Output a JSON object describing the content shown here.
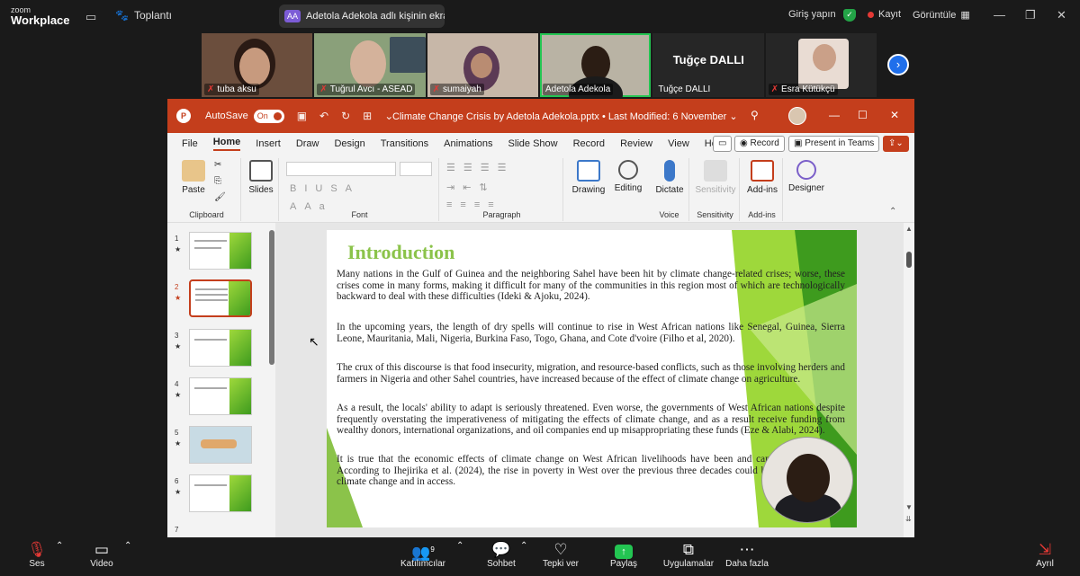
{
  "zoom": {
    "brand_line1": "zoom",
    "brand_line2": "Workplace",
    "meeting_label": "Toplantı",
    "share_label": "Adetola Adekola adlı kişinin ekra",
    "share_badge": "AA",
    "sign_in": "Giriş yapın",
    "record": "Kayıt",
    "view": "Görüntüle",
    "participants": [
      {
        "name": "tuba aksu",
        "muted": true
      },
      {
        "name": "Tuğrul Avcı - ASEAD",
        "muted": true
      },
      {
        "name": "sumaiyah",
        "muted": true
      },
      {
        "name": "Adetola Adekola",
        "muted": false
      },
      {
        "name": "Tuğçe DALLI",
        "muted": false,
        "big_name": "Tuğçe DALLI"
      },
      {
        "name": "Esra Kütükçü",
        "muted": true
      }
    ],
    "bottom": {
      "audio": "Ses",
      "video": "Video",
      "participants": "Katılımcılar",
      "participant_count": "9",
      "chat": "Sohbet",
      "react": "Tepki ver",
      "share": "Paylaş",
      "apps": "Uygulamalar",
      "more": "Daha fazla",
      "leave": "Ayrıl"
    }
  },
  "ppt": {
    "autosave": "AutoSave",
    "toggle": "On",
    "doc_title": "Climate Change Crisis by Adetola Adekola.pptx • Last Modified: 6 November",
    "menu": [
      "File",
      "Home",
      "Insert",
      "Draw",
      "Design",
      "Transitions",
      "Animations",
      "Slide Show",
      "Record",
      "Review",
      "View",
      "Help"
    ],
    "record_btn": "Record",
    "present_btn": "Present in Teams",
    "ribbon": {
      "paste": "Paste",
      "clipboard": "Clipboard",
      "slides": "Slides",
      "font": "Font",
      "paragraph": "Paragraph",
      "drawing": "Drawing",
      "editing": "Editing",
      "dictate": "Dictate",
      "voice": "Voice",
      "sensitivity": "Sensitivity",
      "sensitivity_group": "Sensitivity",
      "addins": "Add-ins",
      "addins_group": "Add-ins",
      "designer": "Designer"
    },
    "thumbs": [
      "1",
      "2",
      "3",
      "4",
      "5",
      "6",
      "7"
    ],
    "slide": {
      "title": "Introduction",
      "paragraphs": [
        "Many nations in the Gulf of Guinea and the neighboring Sahel have been hit by climate change-related crises; worse, these crises come in many forms, making it difficult for many of the communities in this region most of which are technologically backward to deal with these difficulties (Ideki & Ajoku, 2024).",
        "In the upcoming years, the length of dry spells will continue to rise in West African nations like Senegal, Guinea, Sierra Leone, Mauritania, Mali, Nigeria, Burkina Faso, Togo, Ghana, and Cote d'voire (Filho et al, 2020).",
        "The crux of this discourse is that food insecurity, migration, and resource-based conflicts, such as those involving herders and farmers in Nigeria and other Sahel countries, have increased because of the effect of climate change on agriculture.",
        "As a result, the locals' ability to adapt is seriously threatened. Even worse, the governments of West African nations despite frequently overstating the imperativeness of mitigating the effects of climate change, and as a result receive funding from wealthy donors, international organizations, and oil companies end up misappropriating these funds (Eze & Alabi, 2024).",
        "It is true that the economic effects of climate change on West African livelihoods have been and cannot be overstated. According to Ihejirika et al. (2024), the rise in poverty in West over the previous three decades could be attributed to both climate change and in access."
      ]
    }
  }
}
